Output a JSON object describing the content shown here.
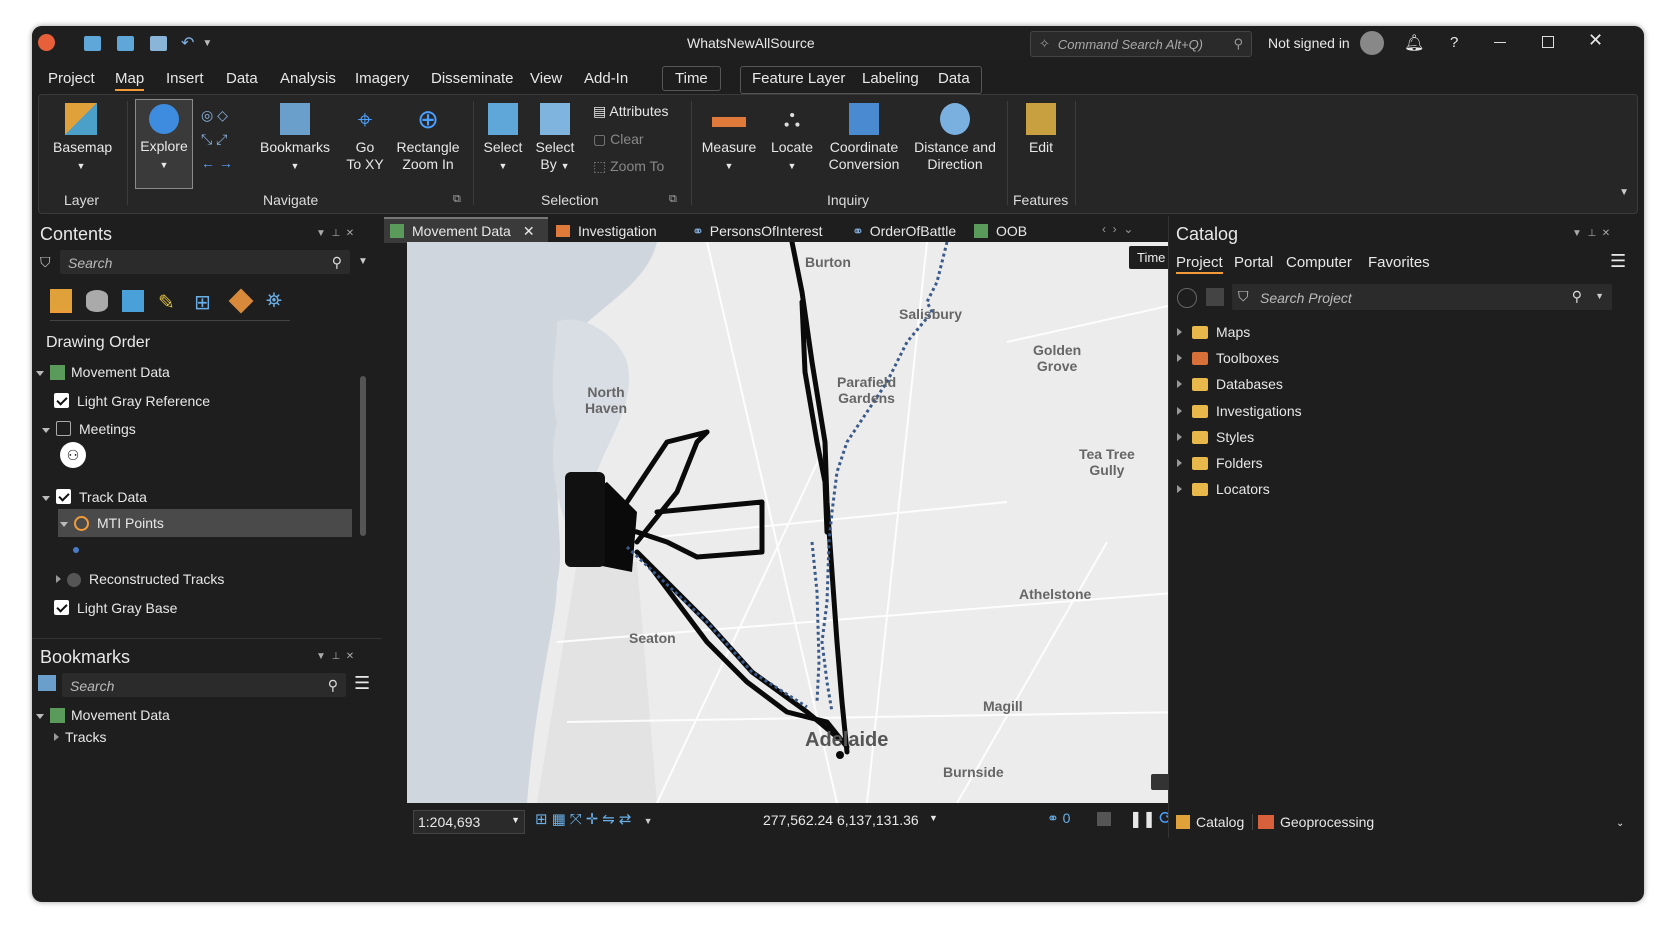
{
  "window": {
    "title": "WhatsNewAllSource",
    "command_search_placeholder": "Command Search Alt+Q)",
    "user_status": "Not signed in",
    "help_label": "?"
  },
  "menu": {
    "items": [
      "Project",
      "Map",
      "Insert",
      "Data",
      "Analysis",
      "Imagery",
      "Disseminate",
      "View",
      "Add-In"
    ],
    "context_time": "Time",
    "context_tabs": [
      "Feature Layer",
      "Labeling",
      "Data"
    ]
  },
  "ribbon": {
    "layer": {
      "basemap": "Basemap",
      "group": "Layer"
    },
    "navigate": {
      "explore": "Explore",
      "bookmarks": "Bookmarks",
      "go_to_xy_1": "Go",
      "go_to_xy_2": "To XY",
      "rect_zoom_1": "Rectangle",
      "rect_zoom_2": "Zoom In",
      "group": "Navigate"
    },
    "selection": {
      "select": "Select",
      "select_by_1": "Select",
      "select_by_2": "By",
      "attributes": "Attributes",
      "clear": "Clear",
      "zoom_to": "Zoom To",
      "group": "Selection"
    },
    "inquiry": {
      "measure": "Measure",
      "locate": "Locate",
      "coord_1": "Coordinate",
      "coord_2": "Conversion",
      "dist_1": "Distance and",
      "dist_2": "Direction",
      "group": "Inquiry"
    },
    "features": {
      "edit": "Edit",
      "group": "Features"
    }
  },
  "contents": {
    "title": "Contents",
    "search_placeholder": "Search",
    "section": "Drawing Order",
    "items": {
      "movement": "Movement Data",
      "light_gray_ref": "Light Gray Reference",
      "meetings": "Meetings",
      "track_data": "Track Data",
      "mti_points": "MTI Points",
      "recon_tracks": "Reconstructed Tracks",
      "light_gray_base": "Light Gray Base"
    }
  },
  "bookmarks": {
    "title": "Bookmarks",
    "search_placeholder": "Search",
    "items": {
      "movement": "Movement Data",
      "tracks": "Tracks"
    }
  },
  "map_tabs": [
    "Movement Data",
    "Investigation",
    "PersonsOfInterest",
    "OrderOfBattle",
    "OOB"
  ],
  "map": {
    "time_button": "Time",
    "labels": {
      "burton": "Burton",
      "salisbury": "Salisbury",
      "golden_grove": "Golden\nGrove",
      "parafield": "Parafield\nGardens",
      "north_haven": "North\nHaven",
      "tea_tree": "Tea Tree\nGully",
      "athelstone": "Athelstone",
      "seaton": "Seaton",
      "magill": "Magill",
      "adelaide": "Adelaide",
      "burnside": "Burnside"
    }
  },
  "statusbar": {
    "scale": "1:204,693",
    "coordinates": "277,562.24 6,137,131.36",
    "selected_count": "0"
  },
  "catalog": {
    "title": "Catalog",
    "tabs": [
      "Project",
      "Portal",
      "Computer",
      "Favorites"
    ],
    "search_placeholder": "Search Project",
    "items": [
      "Maps",
      "Toolboxes",
      "Databases",
      "Investigations",
      "Styles",
      "Folders",
      "Locators"
    ],
    "bottom_tabs": [
      "Catalog",
      "Geoprocessing"
    ]
  },
  "colors": {
    "accent": "#f29b38",
    "track": "#0a0a0a",
    "points": "#3a5a8c"
  }
}
